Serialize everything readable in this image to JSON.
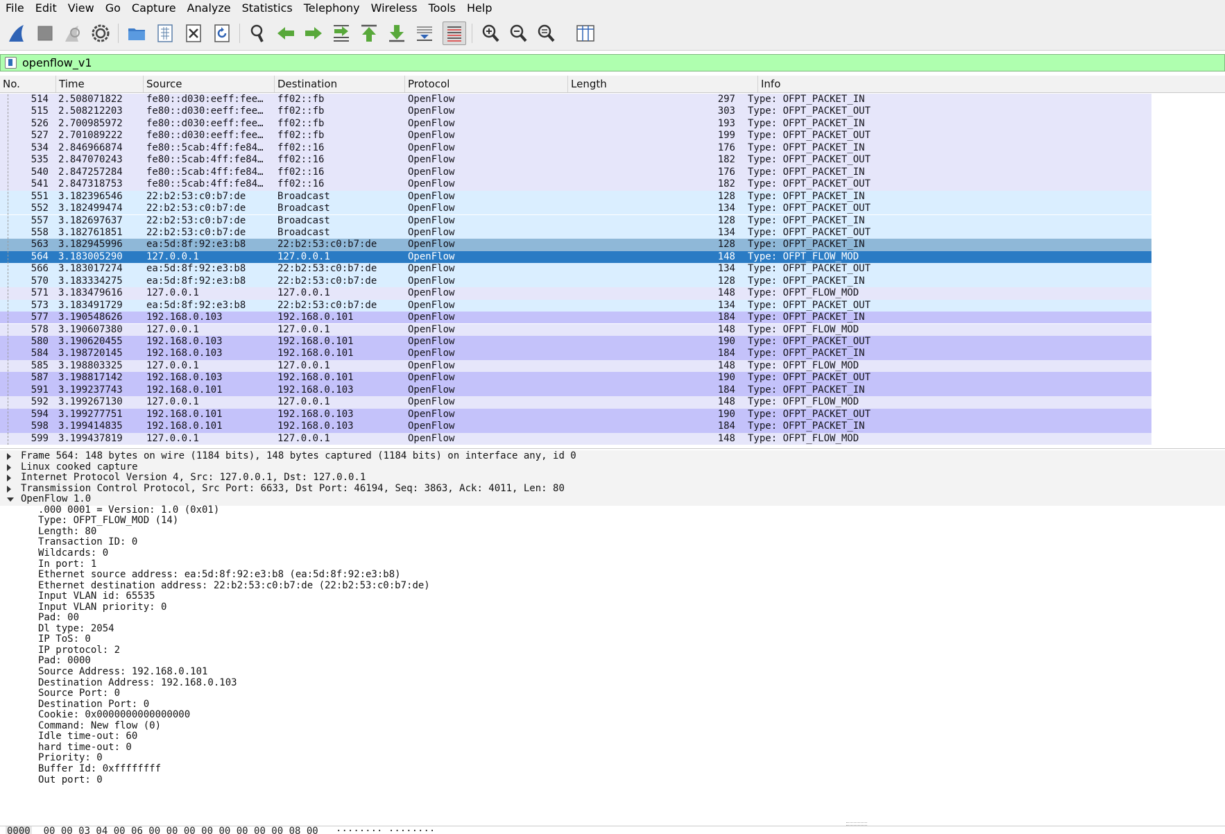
{
  "menu": [
    "File",
    "Edit",
    "View",
    "Go",
    "Capture",
    "Analyze",
    "Statistics",
    "Telephony",
    "Wireless",
    "Tools",
    "Help"
  ],
  "toolbar_icons": [
    "shark-fin-icon",
    "stop-square-icon",
    "restart-fin-icon",
    "gear-options-icon",
    "folder-open-icon",
    "file-grid-icon",
    "close-file-icon",
    "reload-icon",
    "magnifier-icon",
    "arrow-left-icon",
    "arrow-right-icon",
    "goto-packet-icon",
    "arrow-up-first-icon",
    "arrow-down-last-icon",
    "autoscroll-icon",
    "colorize-icon",
    "zoom-in-icon",
    "zoom-out-icon",
    "zoom-reset-icon",
    "resize-columns-icon"
  ],
  "filter": {
    "value": "openflow_v1"
  },
  "packet_list": {
    "columns": [
      "No.",
      "Time",
      "Source",
      "Destination",
      "Protocol",
      "Length",
      "Info"
    ],
    "rows": [
      {
        "no": "514",
        "time": "2.508071822",
        "src": "fe80::d030:eeff:fee…",
        "dst": "ff02::fb",
        "proto": "OpenFlow",
        "len": "297",
        "info": "Type: OFPT_PACKET_IN",
        "bg": "#e6e6fa"
      },
      {
        "no": "515",
        "time": "2.508212203",
        "src": "fe80::d030:eeff:fee…",
        "dst": "ff02::fb",
        "proto": "OpenFlow",
        "len": "303",
        "info": "Type: OFPT_PACKET_OUT",
        "bg": "#e6e6fa"
      },
      {
        "no": "526",
        "time": "2.700985972",
        "src": "fe80::d030:eeff:fee…",
        "dst": "ff02::fb",
        "proto": "OpenFlow",
        "len": "193",
        "info": "Type: OFPT_PACKET_IN",
        "bg": "#e6e6fa"
      },
      {
        "no": "527",
        "time": "2.701089222",
        "src": "fe80::d030:eeff:fee…",
        "dst": "ff02::fb",
        "proto": "OpenFlow",
        "len": "199",
        "info": "Type: OFPT_PACKET_OUT",
        "bg": "#e6e6fa"
      },
      {
        "no": "534",
        "time": "2.846966874",
        "src": "fe80::5cab:4ff:fe84…",
        "dst": "ff02::16",
        "proto": "OpenFlow",
        "len": "176",
        "info": "Type: OFPT_PACKET_IN",
        "bg": "#e6e6fa"
      },
      {
        "no": "535",
        "time": "2.847070243",
        "src": "fe80::5cab:4ff:fe84…",
        "dst": "ff02::16",
        "proto": "OpenFlow",
        "len": "182",
        "info": "Type: OFPT_PACKET_OUT",
        "bg": "#e6e6fa"
      },
      {
        "no": "540",
        "time": "2.847257284",
        "src": "fe80::5cab:4ff:fe84…",
        "dst": "ff02::16",
        "proto": "OpenFlow",
        "len": "176",
        "info": "Type: OFPT_PACKET_IN",
        "bg": "#e6e6fa"
      },
      {
        "no": "541",
        "time": "2.847318753",
        "src": "fe80::5cab:4ff:fe84…",
        "dst": "ff02::16",
        "proto": "OpenFlow",
        "len": "182",
        "info": "Type: OFPT_PACKET_OUT",
        "bg": "#e6e6fa"
      },
      {
        "no": "551",
        "time": "3.182396546",
        "src": "22:b2:53:c0:b7:de",
        "dst": "Broadcast",
        "proto": "OpenFlow",
        "len": "128",
        "info": "Type: OFPT_PACKET_IN",
        "bg": "#daeeff"
      },
      {
        "no": "552",
        "time": "3.182499474",
        "src": "22:b2:53:c0:b7:de",
        "dst": "Broadcast",
        "proto": "OpenFlow",
        "len": "134",
        "info": "Type: OFPT_PACKET_OUT",
        "bg": "#daeeff"
      },
      {
        "no": "557",
        "time": "3.182697637",
        "src": "22:b2:53:c0:b7:de",
        "dst": "Broadcast",
        "proto": "OpenFlow",
        "len": "128",
        "info": "Type: OFPT_PACKET_IN",
        "bg": "#daeeff"
      },
      {
        "no": "558",
        "time": "3.182761851",
        "src": "22:b2:53:c0:b7:de",
        "dst": "Broadcast",
        "proto": "OpenFlow",
        "len": "134",
        "info": "Type: OFPT_PACKET_OUT",
        "bg": "#daeeff"
      },
      {
        "no": "563",
        "time": "3.182945996",
        "src": "ea:5d:8f:92:e3:b8",
        "dst": "22:b2:53:c0:b7:de",
        "proto": "OpenFlow",
        "len": "128",
        "info": "Type: OFPT_PACKET_IN",
        "bg": "#8fb8d8",
        "related": true
      },
      {
        "no": "564",
        "time": "3.183005290",
        "src": "127.0.0.1",
        "dst": "127.0.0.1",
        "proto": "OpenFlow",
        "len": "148",
        "info": "Type: OFPT_FLOW_MOD",
        "bg": "#2a7bc4",
        "selected": true
      },
      {
        "no": "566",
        "time": "3.183017274",
        "src": "ea:5d:8f:92:e3:b8",
        "dst": "22:b2:53:c0:b7:de",
        "proto": "OpenFlow",
        "len": "134",
        "info": "Type: OFPT_PACKET_OUT",
        "bg": "#daeeff"
      },
      {
        "no": "570",
        "time": "3.183334275",
        "src": "ea:5d:8f:92:e3:b8",
        "dst": "22:b2:53:c0:b7:de",
        "proto": "OpenFlow",
        "len": "128",
        "info": "Type: OFPT_PACKET_IN",
        "bg": "#daeeff"
      },
      {
        "no": "571",
        "time": "3.183479616",
        "src": "127.0.0.1",
        "dst": "127.0.0.1",
        "proto": "OpenFlow",
        "len": "148",
        "info": "Type: OFPT_FLOW_MOD",
        "bg": "#e6e6fa"
      },
      {
        "no": "573",
        "time": "3.183491729",
        "src": "ea:5d:8f:92:e3:b8",
        "dst": "22:b2:53:c0:b7:de",
        "proto": "OpenFlow",
        "len": "134",
        "info": "Type: OFPT_PACKET_OUT",
        "bg": "#daeeff"
      },
      {
        "no": "577",
        "time": "3.190548626",
        "src": "192.168.0.103",
        "dst": "192.168.0.101",
        "proto": "OpenFlow",
        "len": "184",
        "info": "Type: OFPT_PACKET_IN",
        "bg": "#c4c2fa"
      },
      {
        "no": "578",
        "time": "3.190607380",
        "src": "127.0.0.1",
        "dst": "127.0.0.1",
        "proto": "OpenFlow",
        "len": "148",
        "info": "Type: OFPT_FLOW_MOD",
        "bg": "#e6e6fa"
      },
      {
        "no": "580",
        "time": "3.190620455",
        "src": "192.168.0.103",
        "dst": "192.168.0.101",
        "proto": "OpenFlow",
        "len": "190",
        "info": "Type: OFPT_PACKET_OUT",
        "bg": "#c4c2fa"
      },
      {
        "no": "584",
        "time": "3.198720145",
        "src": "192.168.0.103",
        "dst": "192.168.0.101",
        "proto": "OpenFlow",
        "len": "184",
        "info": "Type: OFPT_PACKET_IN",
        "bg": "#c4c2fa"
      },
      {
        "no": "585",
        "time": "3.198803325",
        "src": "127.0.0.1",
        "dst": "127.0.0.1",
        "proto": "OpenFlow",
        "len": "148",
        "info": "Type: OFPT_FLOW_MOD",
        "bg": "#e6e6fa"
      },
      {
        "no": "587",
        "time": "3.198817142",
        "src": "192.168.0.103",
        "dst": "192.168.0.101",
        "proto": "OpenFlow",
        "len": "190",
        "info": "Type: OFPT_PACKET_OUT",
        "bg": "#c4c2fa"
      },
      {
        "no": "591",
        "time": "3.199237743",
        "src": "192.168.0.101",
        "dst": "192.168.0.103",
        "proto": "OpenFlow",
        "len": "184",
        "info": "Type: OFPT_PACKET_IN",
        "bg": "#c4c2fa"
      },
      {
        "no": "592",
        "time": "3.199267130",
        "src": "127.0.0.1",
        "dst": "127.0.0.1",
        "proto": "OpenFlow",
        "len": "148",
        "info": "Type: OFPT_FLOW_MOD",
        "bg": "#e6e6fa"
      },
      {
        "no": "594",
        "time": "3.199277751",
        "src": "192.168.0.101",
        "dst": "192.168.0.103",
        "proto": "OpenFlow",
        "len": "190",
        "info": "Type: OFPT_PACKET_OUT",
        "bg": "#c4c2fa"
      },
      {
        "no": "598",
        "time": "3.199414835",
        "src": "192.168.0.101",
        "dst": "192.168.0.103",
        "proto": "OpenFlow",
        "len": "184",
        "info": "Type: OFPT_PACKET_IN",
        "bg": "#c4c2fa"
      },
      {
        "no": "599",
        "time": "3.199437819",
        "src": "127.0.0.1",
        "dst": "127.0.0.1",
        "proto": "OpenFlow",
        "len": "148",
        "info": "Type: OFPT_FLOW_MOD",
        "bg": "#e6e6fa"
      }
    ]
  },
  "details": [
    {
      "text": "Frame 564: 148 bytes on wire (1184 bits), 148 bytes captured (1184 bits) on interface any, id 0",
      "level": 0,
      "state": "collapsed"
    },
    {
      "text": "Linux cooked capture",
      "level": 0,
      "state": "collapsed"
    },
    {
      "text": "Internet Protocol Version 4, Src: 127.0.0.1, Dst: 127.0.0.1",
      "level": 0,
      "state": "collapsed"
    },
    {
      "text": "Transmission Control Protocol, Src Port: 6633, Dst Port: 46194, Seq: 3863, Ack: 4011, Len: 80",
      "level": 0,
      "state": "collapsed"
    },
    {
      "text": "OpenFlow 1.0",
      "level": 0,
      "state": "expanded"
    },
    {
      "text": ".000 0001 = Version: 1.0 (0x01)",
      "level": 1
    },
    {
      "text": "Type: OFPT_FLOW_MOD (14)",
      "level": 1
    },
    {
      "text": "Length: 80",
      "level": 1
    },
    {
      "text": "Transaction ID: 0",
      "level": 1
    },
    {
      "text": "Wildcards: 0",
      "level": 1
    },
    {
      "text": "In port: 1",
      "level": 1
    },
    {
      "text": "Ethernet source address: ea:5d:8f:92:e3:b8 (ea:5d:8f:92:e3:b8)",
      "level": 1
    },
    {
      "text": "Ethernet destination address: 22:b2:53:c0:b7:de (22:b2:53:c0:b7:de)",
      "level": 1
    },
    {
      "text": "Input VLAN id: 65535",
      "level": 1
    },
    {
      "text": "Input VLAN priority: 0",
      "level": 1
    },
    {
      "text": "Pad: 00",
      "level": 1
    },
    {
      "text": "Dl type: 2054",
      "level": 1
    },
    {
      "text": "IP ToS: 0",
      "level": 1
    },
    {
      "text": "IP protocol: 2",
      "level": 1
    },
    {
      "text": "Pad: 0000",
      "level": 1
    },
    {
      "text": "Source Address: 192.168.0.101",
      "level": 1
    },
    {
      "text": "Destination Address: 192.168.0.103",
      "level": 1
    },
    {
      "text": "Source Port: 0",
      "level": 1
    },
    {
      "text": "Destination Port: 0",
      "level": 1
    },
    {
      "text": "Cookie: 0x0000000000000000",
      "level": 1
    },
    {
      "text": "Command: New flow (0)",
      "level": 1
    },
    {
      "text": "Idle time-out: 60",
      "level": 1
    },
    {
      "text": "hard time-out: 0",
      "level": 1
    },
    {
      "text": "Priority: 0",
      "level": 1
    },
    {
      "text": "Buffer Id: 0xffffffff",
      "level": 1
    },
    {
      "text": "Out port: 0",
      "level": 1
    }
  ],
  "bytes": {
    "offset": "0000",
    "hex": "00 00 03 04 00 06 00 00  00 00 00 00 00 00 08 00",
    "ascii": "········ ········"
  }
}
